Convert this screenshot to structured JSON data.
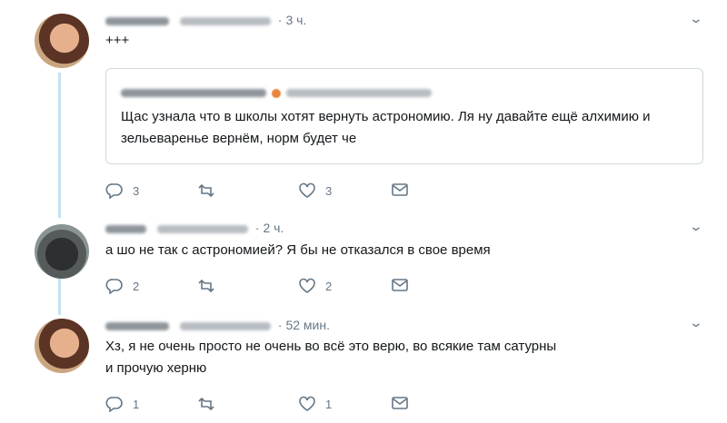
{
  "tweets": [
    {
      "time": "3 ч.",
      "text": "+++",
      "quote": {
        "text": "Щас узнала что в школы хотят вернуть астрономию. Ля ну давайте ещё алхимию и зельеваренье вернём, норм будет че"
      },
      "actions": {
        "reply_count": "3",
        "retweet_count": "",
        "like_count": "3"
      }
    },
    {
      "time": "2 ч.",
      "text": "а шо не так  с астрономией? Я бы не отказался в свое время",
      "actions": {
        "reply_count": "2",
        "retweet_count": "",
        "like_count": "2"
      }
    },
    {
      "time": "52 мин.",
      "text_line1": "Хз, я не очень просто не очень во всё это верю, во всякие там сатурны",
      "text_line2": "и прочую херню",
      "actions": {
        "reply_count": "1",
        "retweet_count": "",
        "like_count": "1"
      }
    }
  ],
  "icons": {
    "reply": "reply-icon",
    "retweet": "retweet-icon",
    "like": "heart-icon",
    "dm": "envelope-icon",
    "menu": "chevron-down-icon"
  },
  "colors": {
    "thread_line": "#c4e2f3",
    "meta_text": "#657786",
    "body_text": "#14171a",
    "quote_border": "#cfd8de"
  }
}
